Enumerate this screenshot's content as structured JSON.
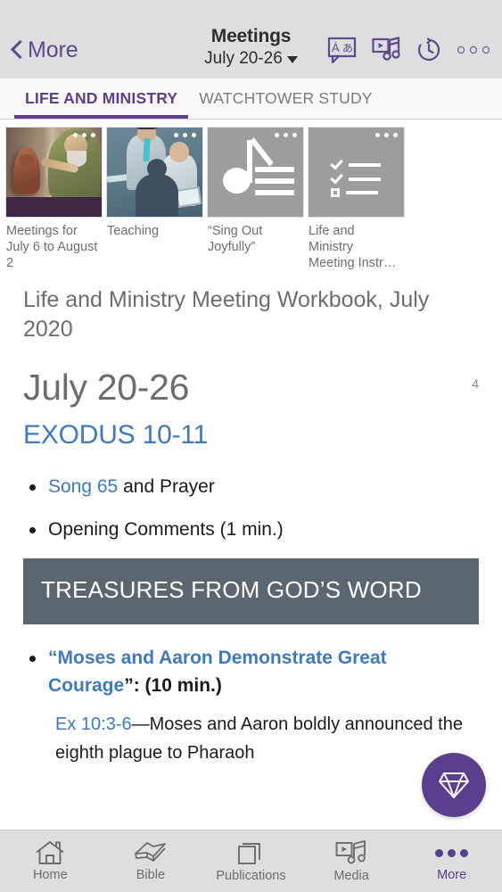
{
  "header": {
    "back_label": "More",
    "back_icon": "chevron-left-icon",
    "title": "Meetings",
    "subtitle": "July 20-26",
    "caret_icon": "chevron-down-icon",
    "actions": [
      {
        "name": "language-icon",
        "label": "Language"
      },
      {
        "name": "media-icon",
        "label": "Media"
      },
      {
        "name": "history-icon",
        "label": "History"
      },
      {
        "name": "overflow-menu-icon",
        "label": "More options"
      }
    ],
    "accent_color": "#5d4a8e",
    "bar_color": "#dedede"
  },
  "tabs": [
    {
      "label": "LIFE AND MINISTRY",
      "active": true
    },
    {
      "label": "WATCHTOWER STUDY",
      "active": false
    }
  ],
  "tab_accent": "#5d3f8f",
  "carousel": [
    {
      "caption": "Meetings for July 6 to August 2",
      "art": "moses-cobra-illustration",
      "dots": "overflow-dots-icon"
    },
    {
      "caption": "Teaching",
      "art": "teaching-illustration",
      "dots": "overflow-dots-icon"
    },
    {
      "caption": "“Sing Out Joyfully”",
      "art": "music-note-icon",
      "dots": "overflow-dots-icon"
    },
    {
      "caption": "Life and Ministry Meeting Instr…",
      "art": "checklist-icon",
      "dots": "overflow-dots-icon"
    }
  ],
  "article": {
    "publication_title": "Life and Ministry Meeting Workbook, July 2020",
    "date_heading": "July 20-26",
    "page_number": "4",
    "scripture_heading": "EXODUS 10-11",
    "items": [
      {
        "link": "Song 65",
        "text": " and Prayer"
      },
      {
        "link": "",
        "text": "Opening Comments (1 min.)"
      }
    ],
    "section_banner": "TREASURES FROM GOD’S WORD",
    "treasure_item": {
      "quote_open": "“",
      "link": "Moses and Aaron Demonstrate Great Courage",
      "quote_close": "”",
      "suffix": ": (10 min.)"
    },
    "nested_item": {
      "link": "Ex 10:3-6",
      "text": "—Moses and Aaron boldly announced the eighth plague to Pharaoh"
    },
    "banner_color": "#5b6770",
    "link_color": "#3e79c2"
  },
  "fab": {
    "name": "gem-icon",
    "color": "#5b3f8f"
  },
  "bottom_nav": [
    {
      "label": "Home",
      "icon": "home-icon",
      "active": false
    },
    {
      "label": "Bible",
      "icon": "book-icon",
      "active": false
    },
    {
      "label": "Publications",
      "icon": "stacked-pages-icon",
      "active": false
    },
    {
      "label": "Media",
      "icon": "media-icon",
      "active": false
    },
    {
      "label": "More",
      "icon": "overflow-dots-icon",
      "active": true
    }
  ]
}
